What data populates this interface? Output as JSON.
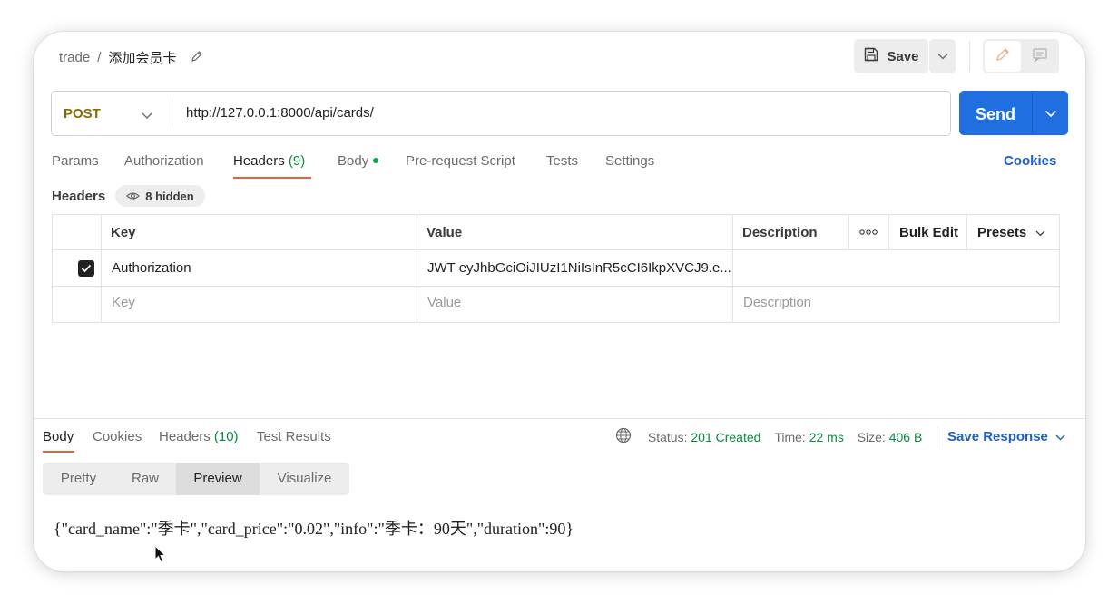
{
  "breadcrumb": {
    "collection": "trade",
    "separator": "/",
    "request_name": "添加会员卡"
  },
  "toolbar": {
    "save_label": "Save"
  },
  "request": {
    "method": "POST",
    "url": "http://127.0.0.1:8000/api/cards/",
    "send_label": "Send"
  },
  "request_tabs": [
    {
      "label": "Params"
    },
    {
      "label": "Authorization"
    },
    {
      "label": "Headers",
      "count": "(9)"
    },
    {
      "label": "Body"
    },
    {
      "label": "Pre-request Script"
    },
    {
      "label": "Tests"
    },
    {
      "label": "Settings"
    }
  ],
  "cookies_link": "Cookies",
  "headers": {
    "label": "Headers",
    "hidden_badge": "8 hidden",
    "columns": {
      "key": "Key",
      "value": "Value",
      "description": "Description",
      "bulk_edit": "Bulk Edit",
      "presets": "Presets"
    },
    "rows": [
      {
        "checked": true,
        "key": "Authorization",
        "value": "JWT eyJhbGciOiJIUzI1NiIsInR5cCI6IkpXVCJ9.e...",
        "description": ""
      }
    ],
    "placeholder": {
      "key": "Key",
      "value": "Value",
      "description": "Description"
    }
  },
  "response_tabs": [
    {
      "label": "Body"
    },
    {
      "label": "Cookies"
    },
    {
      "label": "Headers",
      "count": "(10)"
    },
    {
      "label": "Test Results"
    }
  ],
  "response_status": {
    "status_label": "Status:",
    "status_value": "201 Created",
    "time_label": "Time:",
    "time_value": "22 ms",
    "size_label": "Size:",
    "size_value": "406 B",
    "save_response": "Save Response"
  },
  "view_modes": [
    {
      "label": "Pretty",
      "active": false
    },
    {
      "label": "Raw",
      "active": false
    },
    {
      "label": "Preview",
      "active": true
    },
    {
      "label": "Visualize",
      "active": false
    }
  ],
  "response_body": "{\"card_name\":\"季卡\",\"card_price\":\"0.02\",\"info\":\"季卡：90天\",\"duration\":90}",
  "colors": {
    "accent_tab": "#e8613a",
    "send_button": "#1f6fe0",
    "link": "#1f5fc4",
    "success": "#0a8a3f"
  }
}
